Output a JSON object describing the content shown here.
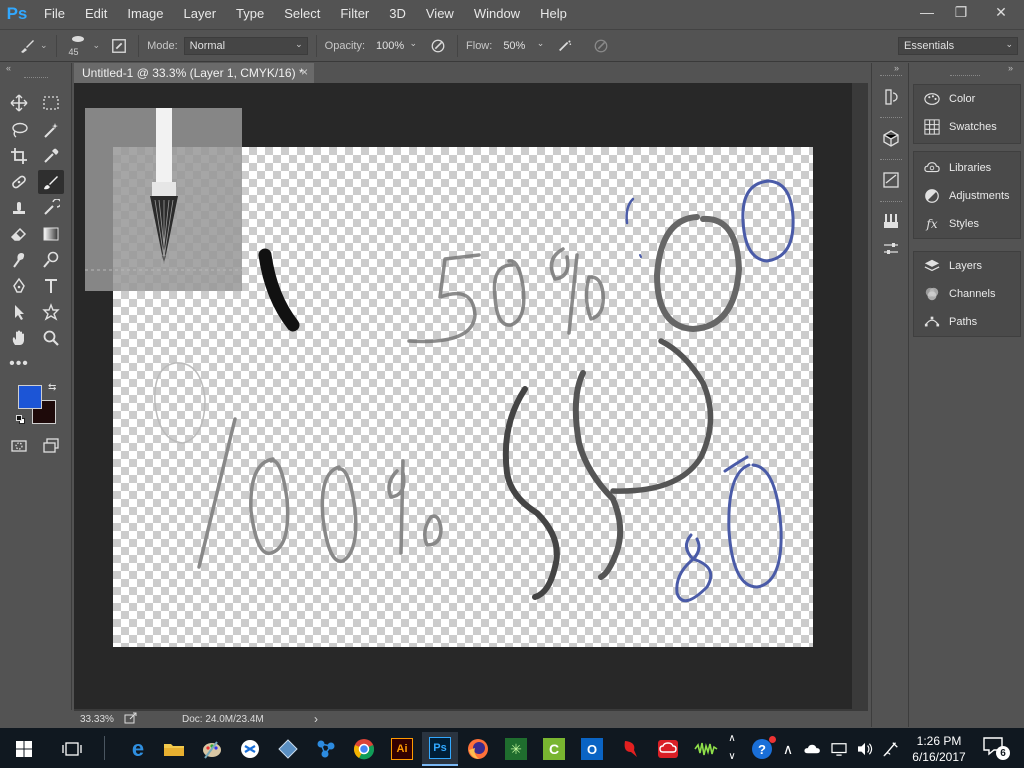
{
  "app": {
    "logo": "Ps",
    "menu": [
      "File",
      "Edit",
      "Image",
      "Layer",
      "Type",
      "Select",
      "Filter",
      "3D",
      "View",
      "Window",
      "Help"
    ],
    "window_controls": {
      "minimize": "—",
      "restore": "❐",
      "close": "✕"
    }
  },
  "options_bar": {
    "brush_size": "45",
    "mode_label": "Mode:",
    "mode_value": "Normal",
    "opacity_label": "Opacity:",
    "opacity_value": "100%",
    "flow_label": "Flow:",
    "flow_value": "50%",
    "workspace": "Essentials"
  },
  "document": {
    "tab_title": "Untitled-1 @ 33.3% (Layer 1, CMYK/16) *",
    "tab_close": "×"
  },
  "status": {
    "zoom": "33.33%",
    "doc_info": "Doc: 24.0M/23.4M",
    "arrow": "›"
  },
  "colors": {
    "foreground": "#1c55d6",
    "background": "#1e0a0a",
    "accent": "#31a8ff"
  },
  "panels": {
    "group1": [
      "Color",
      "Swatches"
    ],
    "group2": [
      "Libraries",
      "Adjustments",
      "Styles"
    ],
    "group3": [
      "Layers",
      "Channels",
      "Paths"
    ]
  },
  "taskbar": {
    "time": "1:26 PM",
    "date": "6/16/2017",
    "notification_count": "6"
  }
}
